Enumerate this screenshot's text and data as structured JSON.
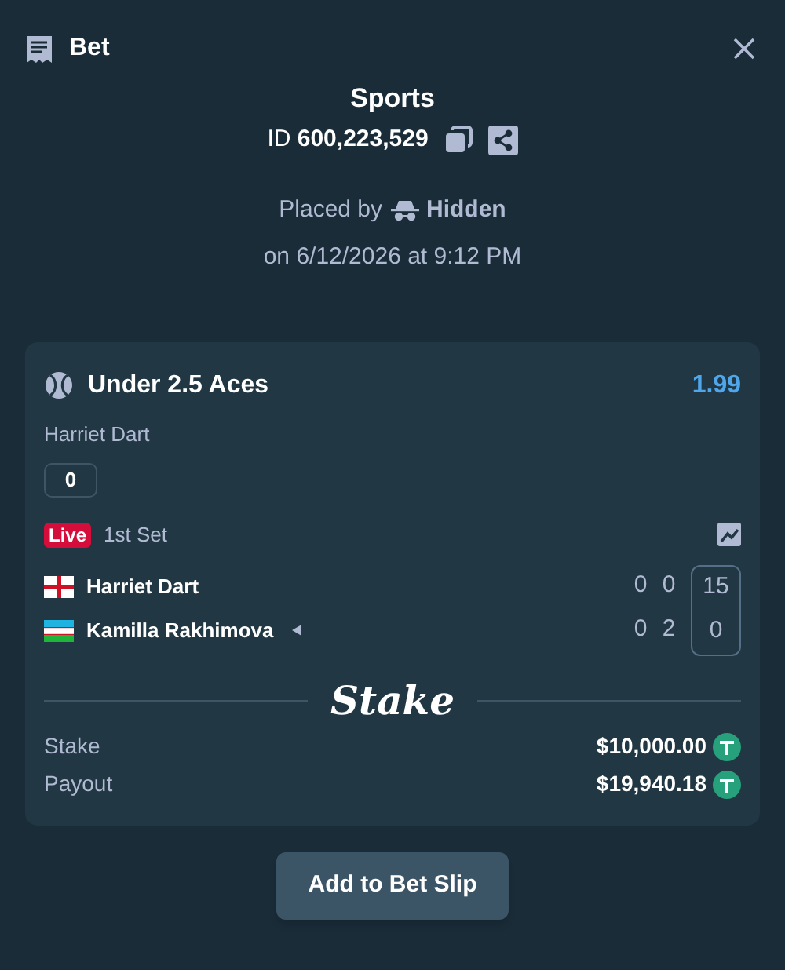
{
  "header": {
    "title": "Bet"
  },
  "summary": {
    "category": "Sports",
    "id_label": "ID",
    "id_value": "600,223,529",
    "placed_by": "Placed by",
    "user": "Hidden",
    "date": "on 6/12/2026 at 9:12 PM"
  },
  "selection": {
    "market": "Under 2.5 Aces",
    "odds": "1.99",
    "outcome": "Harriet Dart",
    "count": "0"
  },
  "event": {
    "status": "Live",
    "period": "1st Set",
    "players": [
      {
        "name": "Harriet Dart",
        "kind": "england",
        "serving": false,
        "scores": [
          "0",
          "0",
          "15"
        ]
      },
      {
        "name": "Kamilla Rakhimova",
        "kind": "uzbekistan",
        "serving": true,
        "scores": [
          "0",
          "2",
          "0"
        ]
      }
    ]
  },
  "brand": "Stake",
  "totals": [
    {
      "label": "Stake",
      "amount": "$10,000.00"
    },
    {
      "label": "Payout",
      "amount": "$19,940.18"
    }
  ],
  "button": "Add to Bet Slip"
}
